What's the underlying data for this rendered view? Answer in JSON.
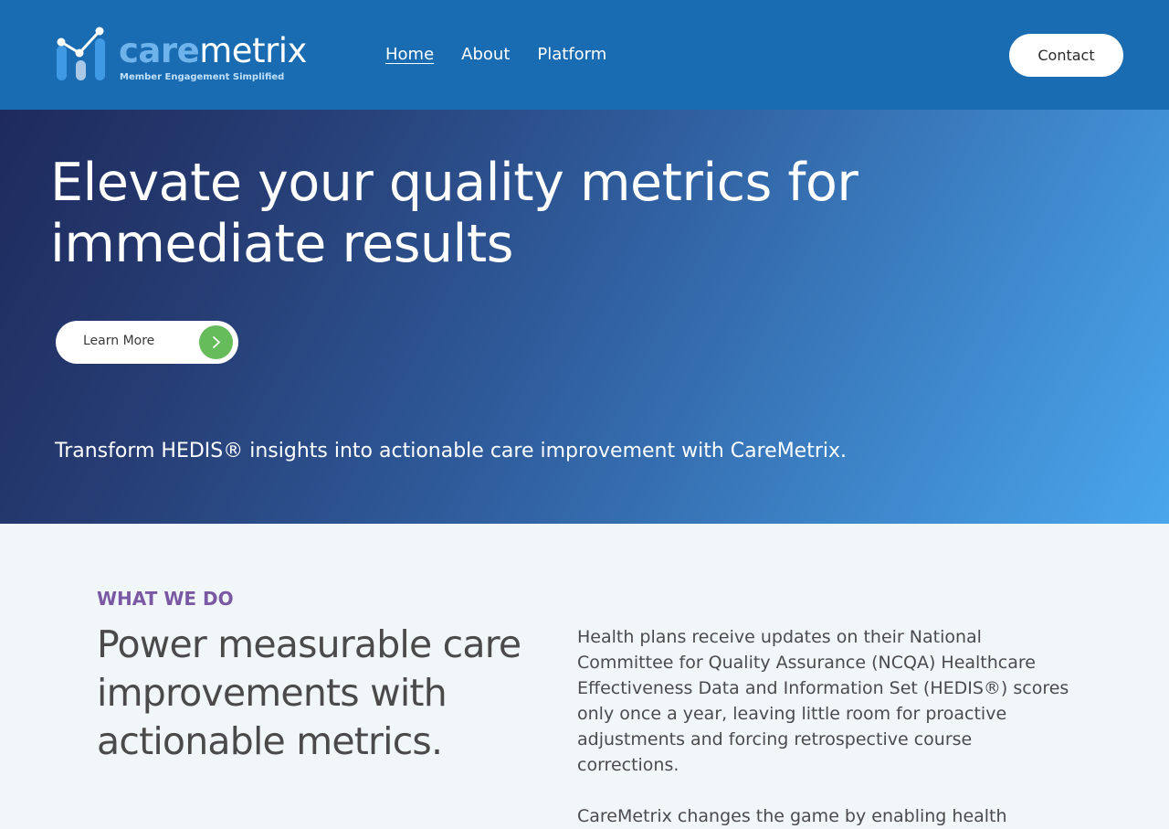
{
  "brand": {
    "name_part1": "care",
    "name_part2": "metrix",
    "tagline": "Member Engagement Simplified"
  },
  "nav": {
    "items": [
      {
        "label": "Home",
        "active": true
      },
      {
        "label": "About",
        "active": false
      },
      {
        "label": "Platform",
        "active": false
      }
    ],
    "contact_label": "Contact"
  },
  "hero": {
    "title": "Elevate your quality metrics for immediate results",
    "cta_label": "Learn More",
    "cta_icon": "chevron-right-icon",
    "subtitle": "Transform HEDIS® insights into actionable care improvement with CareMetrix."
  },
  "what_we_do": {
    "eyebrow": "WHAT WE DO",
    "title": "Power measurable care improvements with actionable metrics.",
    "paragraph_1": "Health plans receive updates on their National Committee for Quality Assurance (NCQA) Healthcare Effectiveness Data and Information Set (HEDIS®) scores only once a year, leaving little room for proactive adjustments and forcing retrospective course corrections.",
    "paragraph_2": "CareMetrix changes the game by enabling health"
  },
  "colors": {
    "header_bg": "#1a6cb2",
    "hero_gradient_start": "#1e2a5c",
    "hero_gradient_end": "#4aa6ec",
    "accent_green": "#66bb5a",
    "eyebrow_purple": "#7a58a4",
    "logo_light_blue": "#6fb3ec"
  }
}
